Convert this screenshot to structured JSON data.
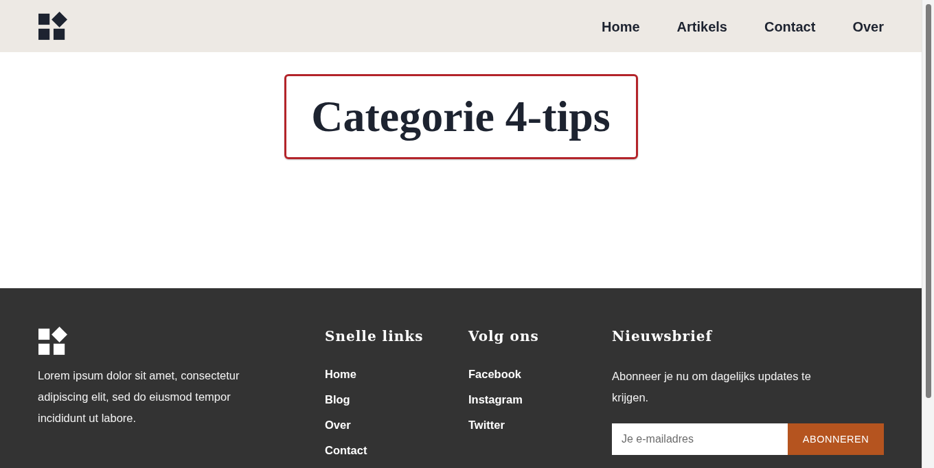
{
  "header": {
    "nav": [
      "Home",
      "Artikels",
      "Contact",
      "Over"
    ]
  },
  "page_title": "Categorie 4-tips",
  "footer": {
    "about": "Lorem ipsum dolor sit amet, consectetur adipiscing elit, sed do eiusmod tempor incididunt ut labore.",
    "columns": [
      {
        "heading": "Snelle links",
        "links": [
          "Home",
          "Blog",
          "Over",
          "Contact"
        ]
      },
      {
        "heading": "Volg ons",
        "links": [
          "Facebook",
          "Instagram",
          "Twitter"
        ]
      }
    ],
    "newsletter": {
      "heading": "Nieuwsbrief",
      "text": "Abonneer je nu om dagelijks updates te krijgen.",
      "placeholder": "Je e-mailadres",
      "button": "ABONNEREN"
    }
  }
}
